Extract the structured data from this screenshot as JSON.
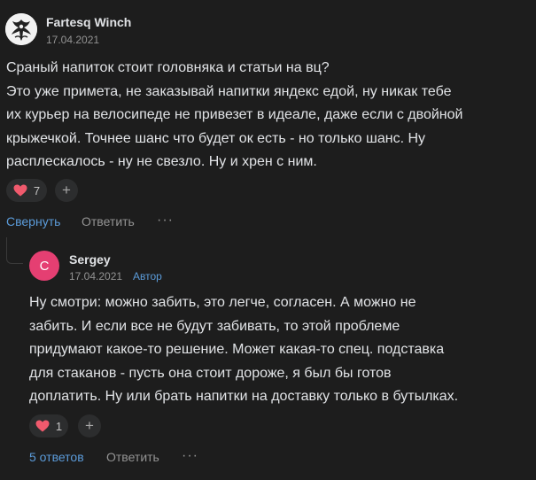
{
  "comment": {
    "author": "Fartesq Winch",
    "date": "17.04.2021",
    "text": "Сраный напиток стоит головняка и статьи на вц?\nЭто уже примета, не заказывай напитки яндекс едой, ну никак тебе\nих курьер на велосипеде не привезет в идеале, даже если с двойной\nкрыжечкой. Точнее шанс что будет ок есть - но только шанс. Ну\nрасплескалось - ну не свезло. Ну и хрен с ним.",
    "reactions": {
      "icon": "heart-icon",
      "count": "7"
    },
    "add_reaction_label": "+",
    "actions": {
      "collapse": "Свернуть",
      "reply": "Ответить",
      "more": "···"
    }
  },
  "reply": {
    "author": "Sergey",
    "avatar_letter": "С",
    "avatar_color": "#e53f72",
    "date": "17.04.2021",
    "badge": "Автор",
    "text": "Ну смотри: можно забить, это легче, согласен. А можно не\nзабить. И если все не будут забивать, то этой проблеме\nпридумают какое-то решение. Может какая-то спец. подставка\nдля стаканов - пусть она стоит дороже, я был бы готов\nдоплатить. Ну или брать напитки на доставку только в бутылках.",
    "reactions": {
      "icon": "heart-icon",
      "count": "1"
    },
    "add_reaction_label": "+",
    "actions": {
      "replies": "5 ответов",
      "reply": "Ответить",
      "more": "···"
    }
  },
  "colors": {
    "background": "#1d1d1d",
    "text": "#e1e3e6",
    "muted": "#939393",
    "link": "#5b9bd9",
    "heart": "#f05a6d"
  }
}
